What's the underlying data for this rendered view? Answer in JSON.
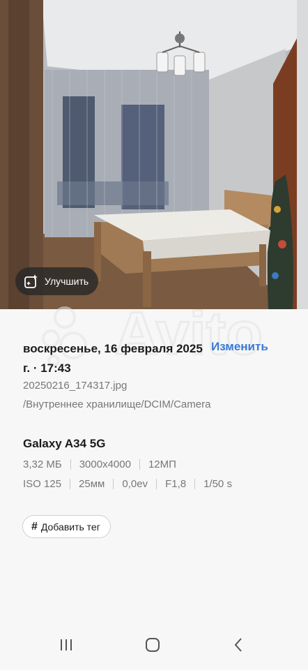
{
  "photo": {
    "enhance_label": "Улучшить"
  },
  "details": {
    "date": "воскресенье, 16 февраля 2025 г. · 17:43",
    "edit_label": "Изменить",
    "file_name": "20250216_174317.jpg",
    "file_path": "/Внутреннее хранилище/DCIM/Camera",
    "device": "Galaxy A34 5G",
    "size": "3,32 МБ",
    "resolution": "3000x4000",
    "megapixels": "12МП",
    "iso": "ISO 125",
    "focal": "25мм",
    "exposure": "0,0ev",
    "aperture": "F1,8",
    "shutter": "1/50 s",
    "add_tag_label": "Добавить тег"
  },
  "watermark": "Avito",
  "colors": {
    "accent": "#3a7bd5",
    "panel_bg": "#f7f7f7",
    "text_primary": "#1b1b1b",
    "text_secondary": "#777777"
  },
  "icons": {
    "enhance": "sparkle-frame-icon",
    "recent_apps": "recent-apps-icon",
    "home": "home-icon",
    "back": "back-icon"
  }
}
